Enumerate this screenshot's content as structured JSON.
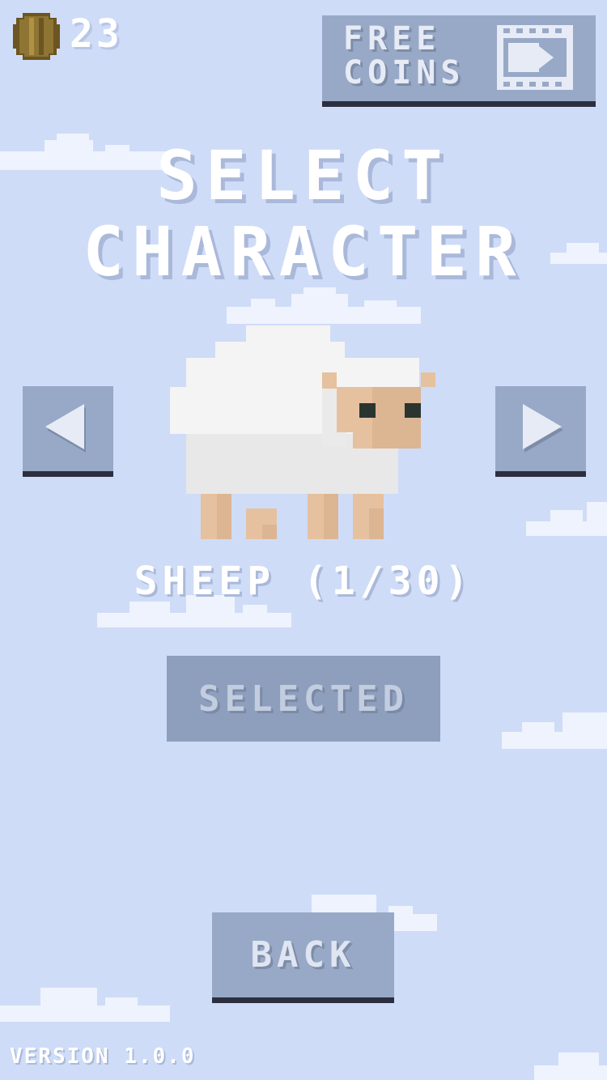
{
  "hud": {
    "coin_icon": "coin-icon",
    "coin_count": "23",
    "free_coins_label": "FREE COINS",
    "film_icon": "film-icon"
  },
  "title": {
    "line1": "SELECT",
    "line2": "CHARACTER"
  },
  "character": {
    "label": "SHEEP (1/30)",
    "sprite": "sheep-sprite"
  },
  "buttons": {
    "prev_icon": "arrow-left-icon",
    "next_icon": "arrow-right-icon",
    "selected_label": "SELECTED",
    "back_label": "BACK"
  },
  "footer": {
    "version": "VERSION 1.0.0"
  },
  "colors": {
    "sky": "#cfdcf7",
    "button": "#98a9c7",
    "button_shadow": "#2c2f3f",
    "cloud": "#eef3fd",
    "coin": "#8a7232"
  }
}
